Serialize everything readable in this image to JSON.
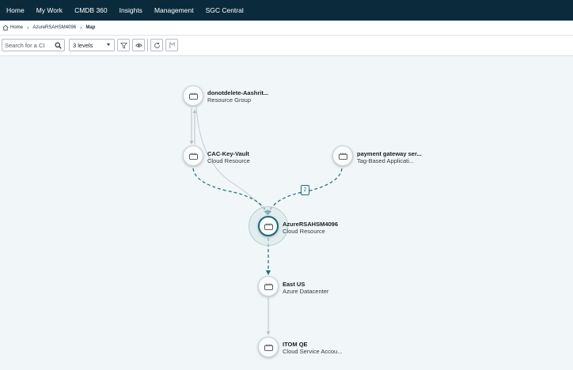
{
  "nav": {
    "items": [
      "Home",
      "My Work",
      "CMDB 360",
      "Insights",
      "Management",
      "SGC Central"
    ]
  },
  "breadcrumb": {
    "items": [
      {
        "label": "Home",
        "icon": "home-icon"
      },
      {
        "label": "AzureRSAHSM4096"
      },
      {
        "label": "Map"
      }
    ]
  },
  "toolbar": {
    "search_placeholder": "Search for a CI",
    "levels_value": "3 levels",
    "buttons": [
      "filter-icon",
      "eye-icon",
      "refresh-icon",
      "flag-icon"
    ]
  },
  "map": {
    "edge_badge": "2",
    "nodes": [
      {
        "title": "donotdelete-Aashrit...",
        "subtitle": "Resource Group"
      },
      {
        "title": "CAC-Key-Vault",
        "subtitle": "Cloud Resource"
      },
      {
        "title": "payment gateway ser...",
        "subtitle": "Tag-Based Applicati..."
      },
      {
        "title": "AzureRSAHSM4096",
        "subtitle": "Cloud Resource",
        "selected": true
      },
      {
        "title": "East US",
        "subtitle": "Azure Datacenter"
      },
      {
        "title": "ITOM QE",
        "subtitle": "Cloud Service Accou..."
      }
    ]
  },
  "colors": {
    "nav_bg": "#0b2b3d",
    "canvas_bg": "#f1f6f8",
    "edge_accent": "#1a6a78"
  }
}
